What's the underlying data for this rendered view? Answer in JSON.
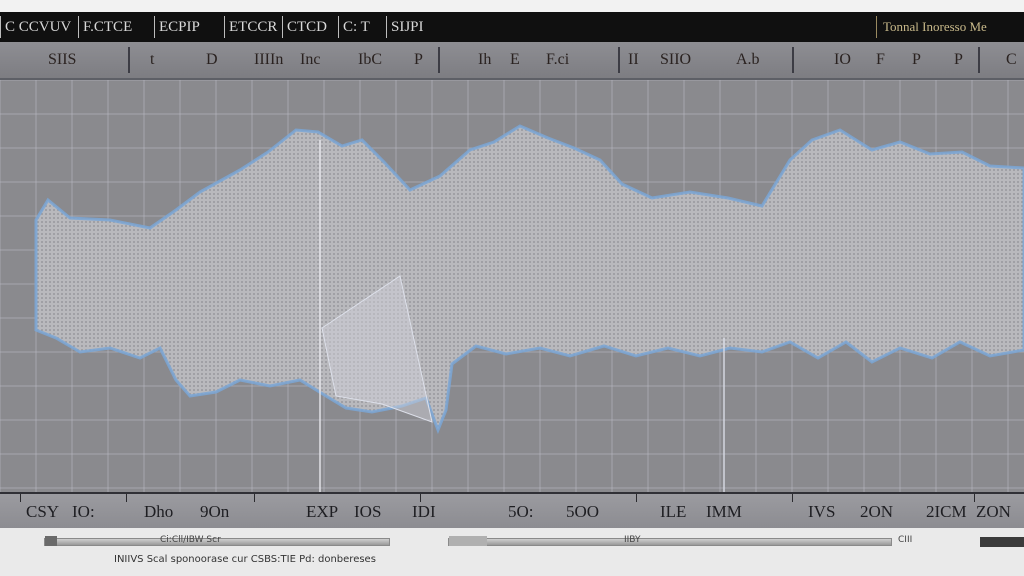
{
  "window": {
    "title_segments": [
      "C CCVUV",
      "F.CTCE",
      "ECPIP",
      "ETCCR",
      "CTCD",
      "C: T",
      "SIJPI"
    ],
    "right_title": "Tonnal Inoresso Me"
  },
  "toolbar": {
    "items": [
      "SIIS",
      "t",
      "D",
      "IIIIn",
      "Inc",
      "IbC",
      "P",
      "Ih",
      "E",
      "F.ci",
      "II",
      "SIIO",
      "A.b",
      "IO",
      "F",
      "P",
      "P",
      "C"
    ]
  },
  "axis": {
    "tick_labels": [
      "CSY",
      "IO:",
      "Dho",
      "9On",
      "EXP",
      "IOS",
      "IDI",
      "5O:",
      "5OO",
      "ILE",
      "IMM",
      "IVS",
      "2ON",
      "2ICM",
      "ZON"
    ]
  },
  "status": {
    "slider_left_label": "Ci:Cll/IBW Scr",
    "slider_mid_label": "IIBY",
    "slider_right_label": "CIII",
    "text": "INIIVS Scal sponoorase cur CSBS:TIE Pd: donbereses"
  },
  "colors": {
    "plot_background": "#8a8a8e",
    "grid_line": "#b9b9c3",
    "waveform_fill": "#c3c3c6",
    "waveform_edge": "#7aa6d6",
    "accent_purple": "#b29bc9"
  }
}
